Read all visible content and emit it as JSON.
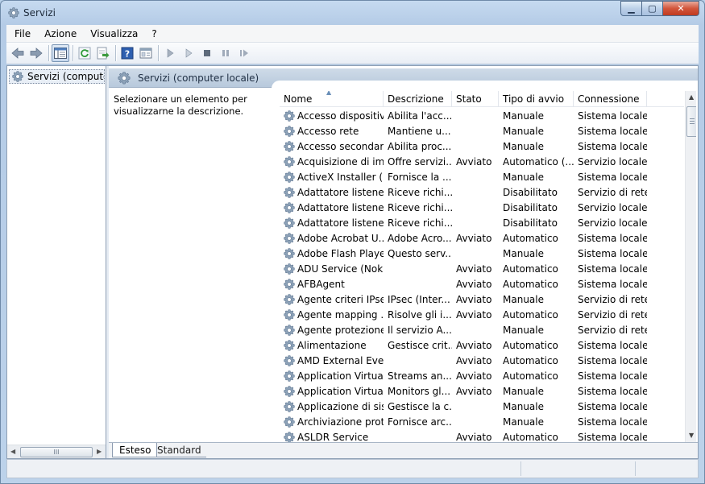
{
  "window": {
    "title": "Servizi"
  },
  "caption": {
    "min": "▁",
    "max": "▢",
    "close": "✕"
  },
  "menu": [
    "File",
    "Azione",
    "Visualizza",
    "?"
  ],
  "tree": {
    "item": "Servizi (computer locale)"
  },
  "tree_scroll": {
    "left": "◀",
    "right": "▶",
    "grip": "III"
  },
  "panel": {
    "title": "Servizi (computer locale)",
    "description": "Selezionare un elemento per visualizzarne la descrizione."
  },
  "list": {
    "columns": [
      "Nome",
      "Descrizione",
      "Stato",
      "Tipo di avvio",
      "Connessione"
    ],
    "sort_indicator": "▲",
    "rows": [
      [
        "Accesso dispositiv...",
        "Abilita l'acc...",
        "",
        "Manuale",
        "Sistema locale"
      ],
      [
        "Accesso rete",
        "Mantiene u...",
        "",
        "Manuale",
        "Sistema locale"
      ],
      [
        "Accesso secondario",
        "Abilita proc...",
        "",
        "Manuale",
        "Sistema locale"
      ],
      [
        "Acquisizione di im...",
        "Offre servizi...",
        "Avviato",
        "Automatico (...",
        "Servizio locale"
      ],
      [
        "ActiveX Installer (...",
        "Fornisce la ...",
        "",
        "Manuale",
        "Sistema locale"
      ],
      [
        "Adattatore listener...",
        "Riceve richi...",
        "",
        "Disabilitato",
        "Servizio di rete"
      ],
      [
        "Adattatore listener...",
        "Riceve richi...",
        "",
        "Disabilitato",
        "Servizio locale"
      ],
      [
        "Adattatore listener...",
        "Riceve richi...",
        "",
        "Disabilitato",
        "Servizio locale"
      ],
      [
        "Adobe Acrobat U...",
        "Adobe Acro...",
        "Avviato",
        "Automatico",
        "Sistema locale"
      ],
      [
        "Adobe Flash Playe...",
        "Questo serv...",
        "",
        "Manuale",
        "Sistema locale"
      ],
      [
        "ADU Service (Noki...",
        "",
        "Avviato",
        "Automatico",
        "Sistema locale"
      ],
      [
        "AFBAgent",
        "",
        "Avviato",
        "Automatico",
        "Sistema locale"
      ],
      [
        "Agente criteri IPsec",
        "IPsec (Inter...",
        "Avviato",
        "Manuale",
        "Servizio di rete"
      ],
      [
        "Agente mapping ...",
        "Risolve gli i...",
        "Avviato",
        "Automatico",
        "Servizio di rete"
      ],
      [
        "Agente protezione...",
        "Il servizio A...",
        "",
        "Manuale",
        "Servizio di rete"
      ],
      [
        "Alimentazione",
        "Gestisce crit...",
        "Avviato",
        "Automatico",
        "Sistema locale"
      ],
      [
        "AMD External Eve...",
        "",
        "Avviato",
        "Automatico",
        "Sistema locale"
      ],
      [
        "Application Virtua...",
        "Streams an...",
        "Avviato",
        "Automatico",
        "Sistema locale"
      ],
      [
        "Application Virtua...",
        "Monitors gl...",
        "Avviato",
        "Manuale",
        "Sistema locale"
      ],
      [
        "Applicazione di sis...",
        "Gestisce la c...",
        "",
        "Manuale",
        "Sistema locale"
      ],
      [
        "Archiviazione prot...",
        "Fornisce arc...",
        "",
        "Manuale",
        "Sistema locale"
      ],
      [
        "ASLDR Service",
        "",
        "Avviato",
        "Automatico",
        "Sistema locale"
      ]
    ]
  },
  "list_scroll": {
    "up": "▲",
    "down": "▼"
  },
  "tabs": [
    "Esteso",
    "Standard"
  ],
  "icons": {
    "title": "gear-icon",
    "back": "back-arrow-icon",
    "forward": "forward-arrow-icon",
    "console": "console-tree-icon",
    "refresh": "refresh-icon",
    "export": "export-list-icon",
    "help": "help-icon",
    "properties": "properties-icon",
    "start": "play-icon",
    "start2": "play-outline-icon",
    "stop": "stop-icon",
    "pause": "pause-icon",
    "restart": "restart-icon"
  },
  "colors": {
    "accent": "#1a5fb4",
    "header_band": "#c4d4e6"
  }
}
